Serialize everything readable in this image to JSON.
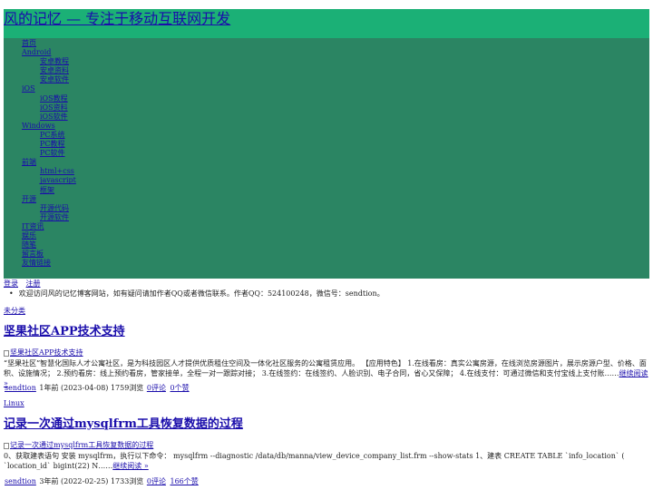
{
  "site": {
    "title": "风的记忆 — 专注于移动互联网开发"
  },
  "nav": [
    {
      "label": "首页",
      "level": 0
    },
    {
      "label": "Android",
      "level": 0
    },
    {
      "label": "安卓教程",
      "level": 1
    },
    {
      "label": "安卓资料",
      "level": 1
    },
    {
      "label": "安卓软件",
      "level": 1
    },
    {
      "label": "iOS",
      "level": 0
    },
    {
      "label": "iOS教程",
      "level": 1
    },
    {
      "label": "iOS资料",
      "level": 1
    },
    {
      "label": "iOS软件",
      "level": 1
    },
    {
      "label": "Windows",
      "level": 0
    },
    {
      "label": "PC系统",
      "level": 1
    },
    {
      "label": "PC教程",
      "level": 1
    },
    {
      "label": "PC软件",
      "level": 1
    },
    {
      "label": "前端",
      "level": 0
    },
    {
      "label": "html+css",
      "level": 1
    },
    {
      "label": "javascript",
      "level": 1
    },
    {
      "label": "框架",
      "level": 1
    },
    {
      "label": "开源",
      "level": 0
    },
    {
      "label": "开源代码",
      "level": 1
    },
    {
      "label": "开源软件",
      "level": 1
    },
    {
      "label": "IT资讯",
      "level": 0
    },
    {
      "label": "娱乐",
      "level": 0
    },
    {
      "label": "随笔",
      "level": 0
    },
    {
      "label": "留言板",
      "level": 0
    },
    {
      "label": "友情链接",
      "level": 0
    }
  ],
  "auth": {
    "login": "登录",
    "register": "注册"
  },
  "notice": "欢迎访问风的记忆博客网站，如有疑问请加作者QQ或者微信联系。作者QQ：524100248，微信号：sendtion。",
  "posts": [
    {
      "category": "未分类",
      "title": "坚果社区APP技术支持",
      "image_alt": "坚果社区APP技术支持",
      "excerpt": "“坚果社区”智慧化国际人才公寓社区，是为科技园区人才提供优质租住空间及一体化社区服务的公寓租赁应用。 【应用特色】 1.在线看房：真实公寓房源，在线浏览房源图片，展示房源户型、价格、面积、设施情况； 2.预约看房：线上预约看房，管家接单，全程一对一跟踪对接； 3.在线签约：在线签约、人脸识别、电子合同，省心又保障； 4.在线支付：可通过微信和支付宝线上支付账……",
      "read_more": "继续阅读 »",
      "author": "sendtion",
      "date": "1年前 (2023-04-08)",
      "views": "1759浏览",
      "comments": "0评论",
      "likes": "0个赞"
    },
    {
      "category": "Linux",
      "title": "记录一次通过mysqlfrm工具恢复数据的过程",
      "image_alt": "记录一次通过mysqlfrm工具恢复数据的过程",
      "excerpt": "0、获取建表语句 安装 mysqlfrm，执行以下命令： mysqlfrm --diagnostic /data/db/manna/view_device_company_list.frm --show-stats 1、建表 CREATE TABLE `info_location` ( `location_id` bigint(22) N……",
      "read_more": "继续阅读 »",
      "author": "sendtion",
      "date": "3年前 (2022-02-25)",
      "views": "1733浏览",
      "comments": "0评论",
      "likes": "166个赞"
    }
  ]
}
